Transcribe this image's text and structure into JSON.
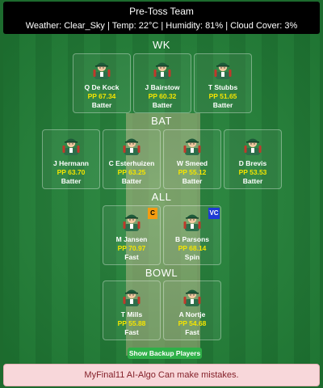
{
  "header": {
    "title": "Pre-Toss Team",
    "weather": "Weather: Clear_Sky | Temp: 22°C | Humidity: 81% | Cloud Cover: 3%"
  },
  "sections": {
    "wk": "WK",
    "bat": "BAT",
    "all": "ALL",
    "bowl": "BOWL"
  },
  "players": {
    "wk": [
      {
        "name": "Q De Kock",
        "pp": "PP 67.34",
        "role": "Batter"
      },
      {
        "name": "J Bairstow",
        "pp": "PP 60.32",
        "role": "Batter"
      },
      {
        "name": "T Stubbs",
        "pp": "PP 51.65",
        "role": "Batter"
      }
    ],
    "bat": [
      {
        "name": "J Hermann",
        "pp": "PP 63.70",
        "role": "Batter"
      },
      {
        "name": "C Esterhuizen",
        "pp": "PP 63.25",
        "role": "Batter"
      },
      {
        "name": "W Smeed",
        "pp": "PP 55.12",
        "role": "Batter"
      },
      {
        "name": "D Brevis",
        "pp": "PP 53.53",
        "role": "Batter"
      }
    ],
    "all": [
      {
        "name": "M Jansen",
        "pp": "PP 70.97",
        "role": "Fast",
        "badge": "C"
      },
      {
        "name": "B Parsons",
        "pp": "PP 68.14",
        "role": "Spin",
        "badge": "VC"
      }
    ],
    "bowl": [
      {
        "name": "T Mills",
        "pp": "PP 55.88",
        "role": "Fast"
      },
      {
        "name": "A Nortje",
        "pp": "PP 54.68",
        "role": "Fast"
      }
    ]
  },
  "backup_button": "Show Backup Players",
  "disclaimer": "MyFinal11 AI-Algo Can make mistakes.",
  "colors": {
    "field": "#1f7a34",
    "pp_text": "#f5e500",
    "captain_badge": "#f39c12",
    "vice_captain_badge": "#1f3bd6",
    "button": "#2fb048",
    "disclaimer_bg": "#f8d7da"
  },
  "icons": {
    "player_avatar": "cricketer-avatar-icon"
  }
}
